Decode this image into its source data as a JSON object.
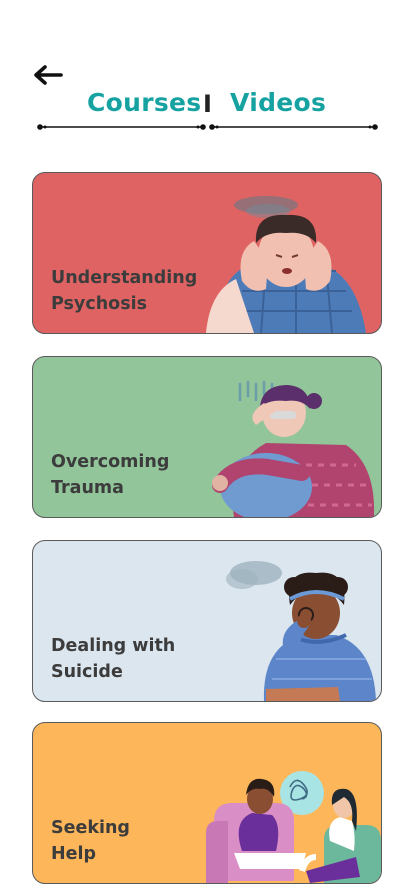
{
  "header": {
    "back_icon": "arrow-left-icon",
    "tabs": [
      {
        "label": "Courses",
        "active": true
      },
      {
        "label": "Videos",
        "active": false
      }
    ],
    "separator": "I",
    "accent_color": "#17a2a2"
  },
  "courses": [
    {
      "title": "Understanding\nPsychosis",
      "bg_color": "#e06363",
      "illustration": "stressed-person-holding-head-icon"
    },
    {
      "title": "Overcoming\nTrauma",
      "bg_color": "#92c59a",
      "illustration": "sad-person-hugging-knees-icon"
    },
    {
      "title": "Dealing with\nSuicide",
      "bg_color": "#dbe6ee",
      "illustration": "crying-person-icon"
    },
    {
      "title": "Seeking\nHelp",
      "bg_color": "#fdb75a",
      "illustration": "therapy-session-icon"
    }
  ]
}
